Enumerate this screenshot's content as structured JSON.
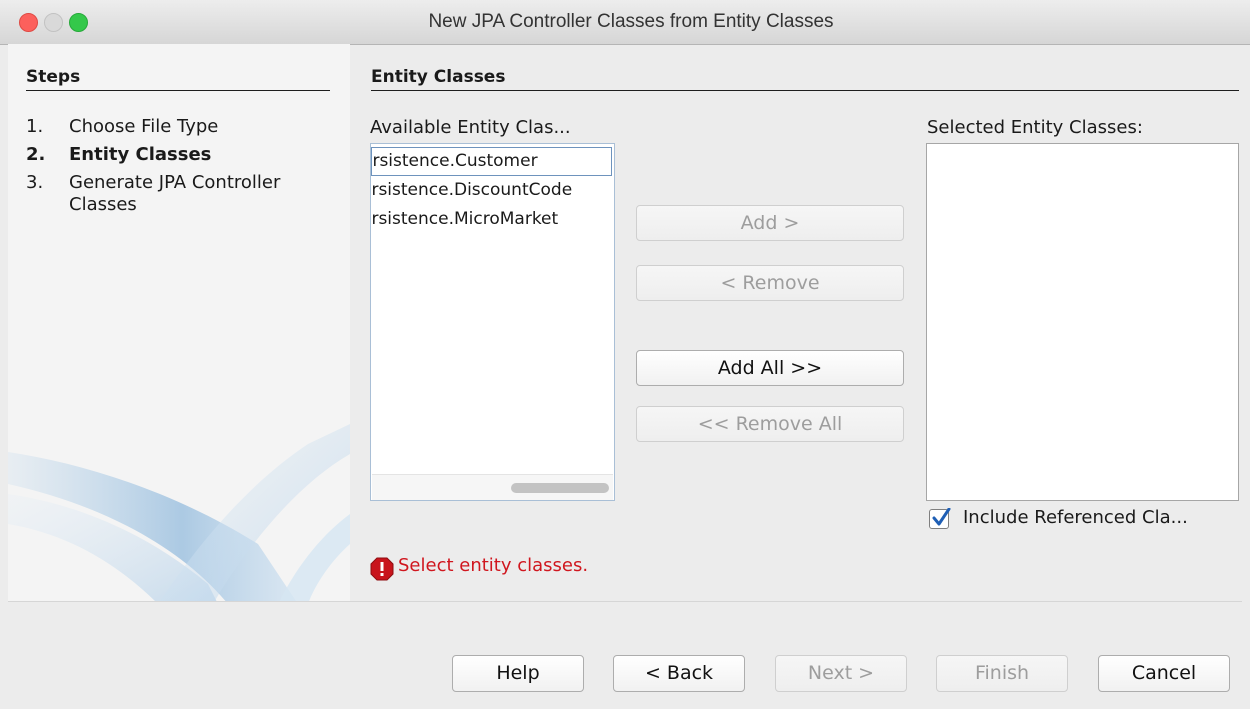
{
  "window": {
    "title": "New JPA Controller Classes from Entity Classes"
  },
  "steps": {
    "heading": "Steps",
    "items": [
      {
        "num": "1.",
        "label": "Choose File Type",
        "current": false
      },
      {
        "num": "2.",
        "label": "Entity Classes",
        "current": true
      },
      {
        "num": "3.",
        "label": "Generate JPA Controller Classes",
        "current": false
      }
    ]
  },
  "panel": {
    "heading": "Entity Classes",
    "available_label": "Available Entity Clas...",
    "available_items": [
      "ersistence.Customer",
      "ersistence.DiscountCode",
      "ersistence.MicroMarket"
    ],
    "selected_label": "Selected Entity Classes:",
    "selected_items": []
  },
  "buttons": {
    "add": "Add >",
    "remove": "< Remove",
    "add_all": "Add All >>",
    "remove_all": "<< Remove All"
  },
  "include_referenced": {
    "label": "Include Referenced Cla...",
    "checked": true
  },
  "error": {
    "message": "Select entity classes.",
    "color": "#d0161e"
  },
  "footer": {
    "help": "Help",
    "back": "< Back",
    "next": "Next >",
    "finish": "Finish",
    "cancel": "Cancel"
  }
}
